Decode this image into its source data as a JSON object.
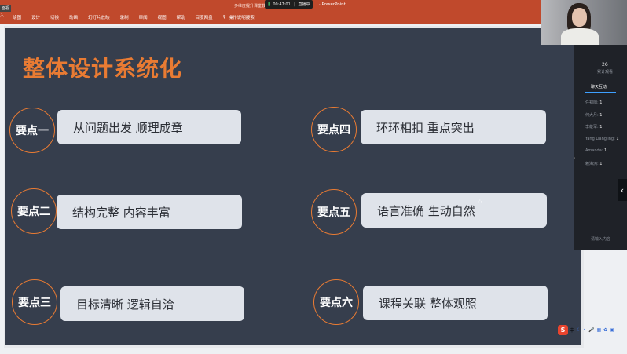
{
  "app": {
    "window_title": "多维度提升课堂教",
    "app_name": "PowerPoint",
    "corner_tag": "面视",
    "left_tab": "入",
    "search_label": "操作说明搜索"
  },
  "ribbon": {
    "tabs": [
      "绘图",
      "设计",
      "切换",
      "动画",
      "幻灯片放映",
      "录制",
      "审阅",
      "视图",
      "帮助",
      "百度网盘"
    ]
  },
  "recording": {
    "time": "00:47:01",
    "status": "直播中"
  },
  "slide": {
    "title": "整体设计系统化",
    "points": [
      {
        "badge": "要点一",
        "text": "从问题出发 顺理成章"
      },
      {
        "badge": "要点二",
        "text": "结构完整 内容丰富"
      },
      {
        "badge": "要点三",
        "text": "目标清晰 逻辑自洽"
      },
      {
        "badge": "要点四",
        "text": "环环相扣 重点突出"
      },
      {
        "badge": "要点五",
        "text": "语言准确 生动自然"
      },
      {
        "badge": "要点六",
        "text": "课程关联 整体观照"
      }
    ]
  },
  "side_panel": {
    "count": "26",
    "subtitle": "累计观看",
    "tab": "聊天互动",
    "rows": [
      {
        "name": "任初阳:",
        "value": "1"
      },
      {
        "name": "何大月:",
        "value": "1"
      },
      {
        "name": "李雄军:",
        "value": "1"
      },
      {
        "name": "Yang Liangjing:",
        "value": "1"
      },
      {
        "name": "Amanda:",
        "value": "1"
      },
      {
        "name": "赖海洲:",
        "value": "1"
      }
    ],
    "footer": "请输入内容"
  },
  "ime": {
    "logo": "S",
    "mode": "中"
  }
}
